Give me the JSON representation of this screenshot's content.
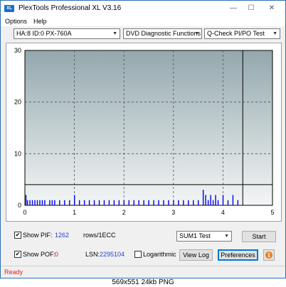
{
  "window": {
    "title": "PlexTools Professional XL V3.16",
    "icon_text": "XL",
    "minimize_glyph": "—",
    "maximize_glyph": "☐",
    "close_glyph": "✕"
  },
  "menu": {
    "options": "Options",
    "help": "Help"
  },
  "toolbar": {
    "drive": "HA:8 ID:0  PX-760A",
    "function": "DVD Diagnostic Functions",
    "test": "Q-Check PI/PO Test"
  },
  "chart_data": {
    "type": "bar",
    "title": "",
    "xlabel": "",
    "ylabel": "",
    "xlim": [
      0,
      5
    ],
    "ylim": [
      0,
      30
    ],
    "x_ticks": [
      "0",
      "1",
      "2",
      "3",
      "4",
      "5"
    ],
    "y_ticks": [
      "0",
      "10",
      "20",
      "30"
    ],
    "grid": true,
    "threshold_line": 4,
    "end_marker_x": 4.4,
    "bar_color": "#0000ee",
    "series": [
      {
        "values_sample": [
          [
            0.02,
            2
          ],
          [
            0.05,
            1
          ],
          [
            0.1,
            1
          ],
          [
            0.15,
            1
          ],
          [
            0.2,
            1
          ],
          [
            0.25,
            1
          ],
          [
            0.3,
            1
          ],
          [
            0.35,
            1
          ],
          [
            0.4,
            1
          ],
          [
            0.5,
            1
          ],
          [
            0.55,
            1
          ],
          [
            0.6,
            1
          ],
          [
            0.7,
            1
          ],
          [
            0.8,
            1
          ],
          [
            0.9,
            1
          ],
          [
            1.0,
            2
          ],
          [
            1.1,
            1
          ],
          [
            1.2,
            1
          ],
          [
            1.3,
            1
          ],
          [
            1.4,
            1
          ],
          [
            1.5,
            1
          ],
          [
            1.6,
            1
          ],
          [
            1.7,
            1
          ],
          [
            1.8,
            1
          ],
          [
            1.9,
            1
          ],
          [
            2.0,
            1
          ],
          [
            2.1,
            1
          ],
          [
            2.2,
            1
          ],
          [
            2.3,
            1
          ],
          [
            2.4,
            1
          ],
          [
            2.5,
            1
          ],
          [
            2.6,
            1
          ],
          [
            2.7,
            1
          ],
          [
            2.8,
            1
          ],
          [
            2.9,
            1
          ],
          [
            3.0,
            1
          ],
          [
            3.1,
            1
          ],
          [
            3.2,
            1
          ],
          [
            3.3,
            1
          ],
          [
            3.4,
            1
          ],
          [
            3.5,
            1
          ],
          [
            3.6,
            3
          ],
          [
            3.65,
            2
          ],
          [
            3.7,
            1
          ],
          [
            3.75,
            2
          ],
          [
            3.8,
            1
          ],
          [
            3.85,
            2
          ],
          [
            3.9,
            1
          ],
          [
            4.0,
            2
          ],
          [
            4.1,
            1
          ],
          [
            4.2,
            2
          ],
          [
            4.3,
            1
          ]
        ]
      }
    ]
  },
  "controls": {
    "show_pif_label": "Show PIF:",
    "pif_value": "1262",
    "pif_unit": "rows/1ECC",
    "show_pof_label": "Show POF:",
    "pof_value": "0",
    "lsn_label": "LSN:",
    "lsn_value": "2295104",
    "logarithmic_label": "Logarithmic",
    "sum_select": "SUM1 Test",
    "start_button": "Start",
    "view_log_button": "View Log",
    "preferences_button": "Preferences",
    "info_glyph": "i",
    "pif_checked": true,
    "pof_checked": true,
    "logarithmic_checked": false
  },
  "status": {
    "text": "Ready"
  },
  "caption": {
    "text": "569x551  24kb  PNG"
  }
}
